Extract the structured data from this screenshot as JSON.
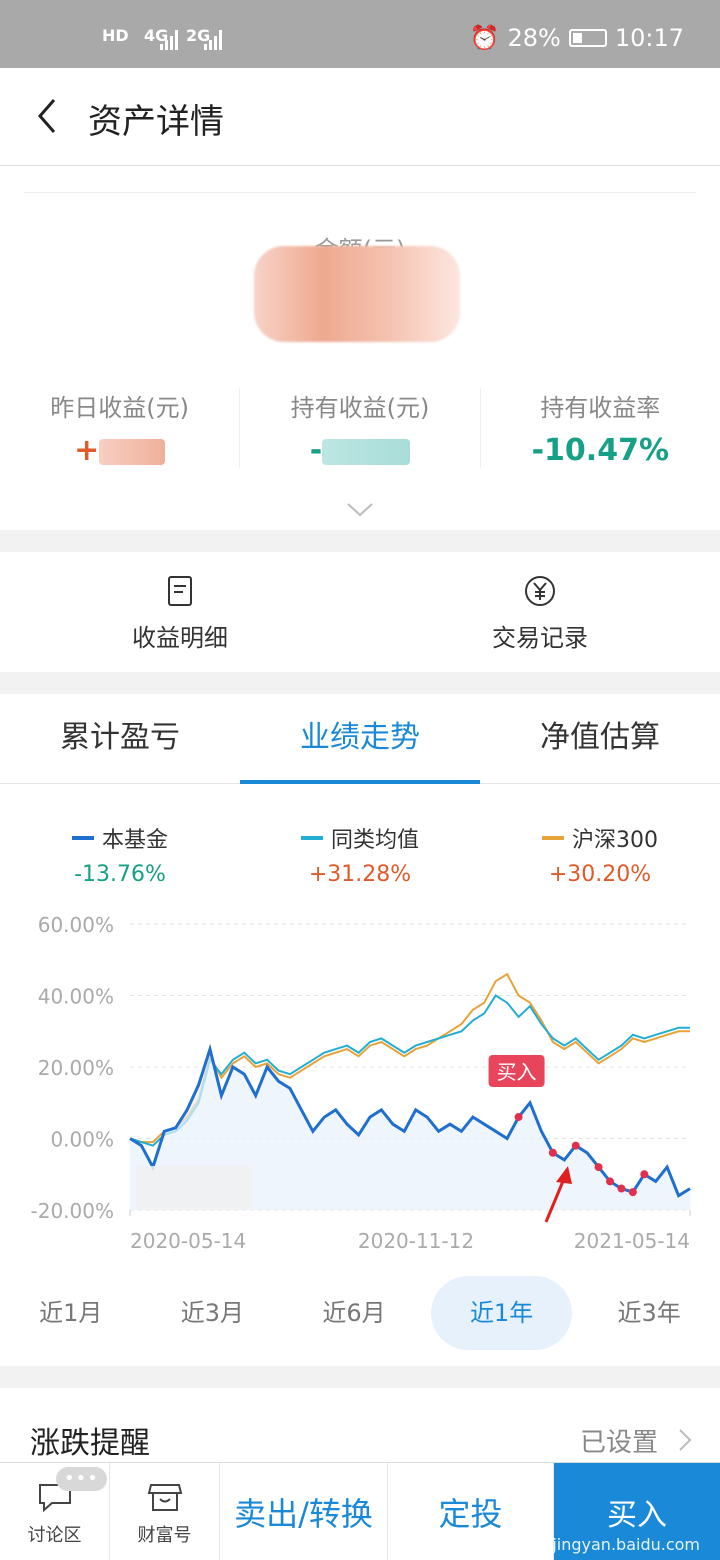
{
  "status_bar": {
    "left_icons": [
      "HD",
      "4G",
      "2G"
    ],
    "battery": "28%",
    "time": "10:17"
  },
  "nav": {
    "title": "资产详情"
  },
  "asset": {
    "amount_label": "金额(元)",
    "stats": [
      {
        "label": "昨日收益(元)",
        "value": "+",
        "color": "orange"
      },
      {
        "label": "持有收益(元)",
        "value": "-",
        "color": "green"
      },
      {
        "label": "持有收益率",
        "value": "-10.47%",
        "color": "green"
      }
    ]
  },
  "actions": [
    {
      "label": "收益明细",
      "icon": "document-icon"
    },
    {
      "label": "交易记录",
      "icon": "yen-circle-icon"
    }
  ],
  "tabs": [
    {
      "label": "累计盈亏",
      "active": false
    },
    {
      "label": "业绩走势",
      "active": true
    },
    {
      "label": "净值估算",
      "active": false
    }
  ],
  "legend": [
    {
      "name": "本基金",
      "pct": "-13.76%",
      "color": "#1f6fcf",
      "pct_color": "green"
    },
    {
      "name": "同类均值",
      "pct": "+31.28%",
      "color": "#22aed3",
      "pct_color": "orange"
    },
    {
      "name": "沪深300",
      "pct": "+30.20%",
      "color": "#e8a23a",
      "pct_color": "orange"
    }
  ],
  "chart_data": {
    "type": "line",
    "y_ticks": [
      "60.00%",
      "40.00%",
      "20.00%",
      "0.00%",
      "-20.00%"
    ],
    "ylim": [
      -20,
      60
    ],
    "x_ticks": [
      "2020-05-14",
      "2020-11-12",
      "2021-05-14"
    ],
    "annotation": "买入",
    "grid": true,
    "series": [
      {
        "name": "本基金",
        "color": "#1f6fcf",
        "values": [
          0,
          -2,
          -8,
          2,
          3,
          8,
          15,
          25,
          12,
          20,
          18,
          12,
          20,
          16,
          14,
          8,
          2,
          6,
          8,
          4,
          1,
          6,
          8,
          4,
          2,
          8,
          6,
          2,
          4,
          2,
          6,
          4,
          2,
          0,
          6,
          10,
          2,
          -4,
          -6,
          -2,
          -4,
          -8,
          -12,
          -14,
          -15,
          -10,
          -12,
          -8,
          -16,
          -14
        ]
      },
      {
        "name": "同类均值",
        "color": "#22aed3",
        "values": [
          0,
          -1,
          -2,
          1,
          2,
          5,
          10,
          22,
          18,
          22,
          24,
          21,
          22,
          19,
          18,
          20,
          22,
          24,
          25,
          26,
          24,
          27,
          28,
          26,
          24,
          26,
          27,
          28,
          29,
          30,
          33,
          35,
          40,
          38,
          34,
          37,
          32,
          28,
          26,
          28,
          25,
          22,
          24,
          26,
          29,
          28,
          29,
          30,
          31,
          31
        ]
      },
      {
        "name": "沪深300",
        "color": "#e8a23a",
        "values": [
          0,
          -1,
          -1,
          2,
          3,
          6,
          11,
          23,
          17,
          21,
          23,
          20,
          21,
          18,
          17,
          19,
          21,
          23,
          24,
          25,
          23,
          26,
          27,
          25,
          23,
          25,
          26,
          28,
          30,
          32,
          36,
          38,
          44,
          46,
          40,
          38,
          33,
          27,
          25,
          27,
          24,
          21,
          23,
          25,
          28,
          27,
          28,
          29,
          30,
          30
        ]
      }
    ]
  },
  "ranges": [
    {
      "label": "近1月",
      "active": false
    },
    {
      "label": "近3月",
      "active": false
    },
    {
      "label": "近6月",
      "active": false
    },
    {
      "label": "近1年",
      "active": true
    },
    {
      "label": "近3年",
      "active": false
    }
  ],
  "alert": {
    "label": "涨跌提醒",
    "value": "已设置"
  },
  "bottom": {
    "discuss": "讨论区",
    "badge": "•••",
    "wealth": "财富号",
    "sell": "卖出/转换",
    "fixed": "定投",
    "buy": "买入",
    "watermark": "jingyan.baidu.com"
  }
}
